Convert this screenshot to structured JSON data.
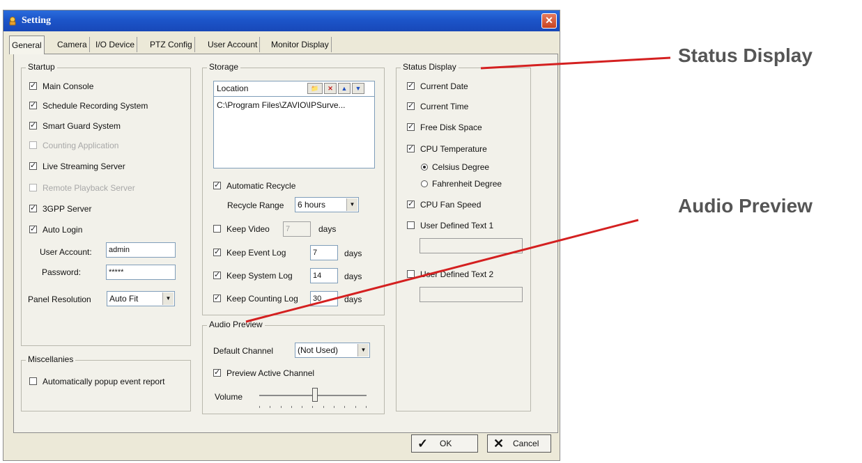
{
  "window": {
    "title": "Setting",
    "close_glyph": "✕"
  },
  "tabs": [
    {
      "label": "General"
    },
    {
      "label": "Camera"
    },
    {
      "label": "I/O Device"
    },
    {
      "label": "PTZ Config"
    },
    {
      "label": "User Account"
    },
    {
      "label": "Monitor Display"
    }
  ],
  "startup": {
    "title": "Startup",
    "items": [
      {
        "label": "Main Console",
        "checked": true
      },
      {
        "label": "Schedule Recording System",
        "checked": true
      },
      {
        "label": "Smart Guard System",
        "checked": true
      },
      {
        "label": "Counting Application",
        "checked": false,
        "disabled": true
      },
      {
        "label": "Live Streaming Server",
        "checked": true
      },
      {
        "label": "Remote Playback Server",
        "checked": false,
        "disabled": true
      },
      {
        "label": "3GPP Server",
        "checked": true
      },
      {
        "label": "Auto Login",
        "checked": true
      }
    ],
    "user_account_label": "User Account:",
    "user_account_value": "admin",
    "password_label": "Password:",
    "password_value": "*****",
    "panel_resolution_label": "Panel Resolution",
    "panel_resolution_value": "Auto Fit"
  },
  "misc": {
    "title": "Miscellanies",
    "auto_popup_label": "Automatically popup event report"
  },
  "storage": {
    "title": "Storage",
    "location_header": "Location",
    "locations": [
      "C:\\Program Files\\ZAVIO\\IPSurve..."
    ],
    "auto_recycle_label": "Automatic Recycle",
    "recycle_range_label": "Recycle Range",
    "recycle_range_value": "6 hours",
    "keep_video_label": "Keep Video",
    "keep_video_value": "7",
    "keep_event_log_label": "Keep Event Log",
    "keep_event_log_value": "7",
    "keep_system_log_label": "Keep System Log",
    "keep_system_log_value": "14",
    "keep_counting_log_label": "Keep Counting Log",
    "keep_counting_log_value": "30",
    "days_label": "days"
  },
  "audio": {
    "title": "Audio Preview",
    "default_channel_label": "Default Channel",
    "default_channel_value": "(Not Used)",
    "preview_active_label": "Preview Active Channel",
    "volume_label": "Volume",
    "volume_level": 0.52
  },
  "status_display": {
    "title": "Status Display",
    "current_date": "Current Date",
    "current_time": "Current Time",
    "free_disk": "Free Disk Space",
    "cpu_temp": "CPU Temperature",
    "celsius": "Celsius Degree",
    "fahrenheit": "Fahrenheit Degree",
    "cpu_fan": "CPU Fan Speed",
    "user_text_1": "User Defined Text 1",
    "user_text_2": "User Defined Text 2"
  },
  "buttons": {
    "ok": "OK",
    "cancel": "Cancel"
  },
  "annotations": {
    "status_display": "Status Display",
    "audio_preview": "Audio Preview",
    "line_color": "#d42020"
  }
}
